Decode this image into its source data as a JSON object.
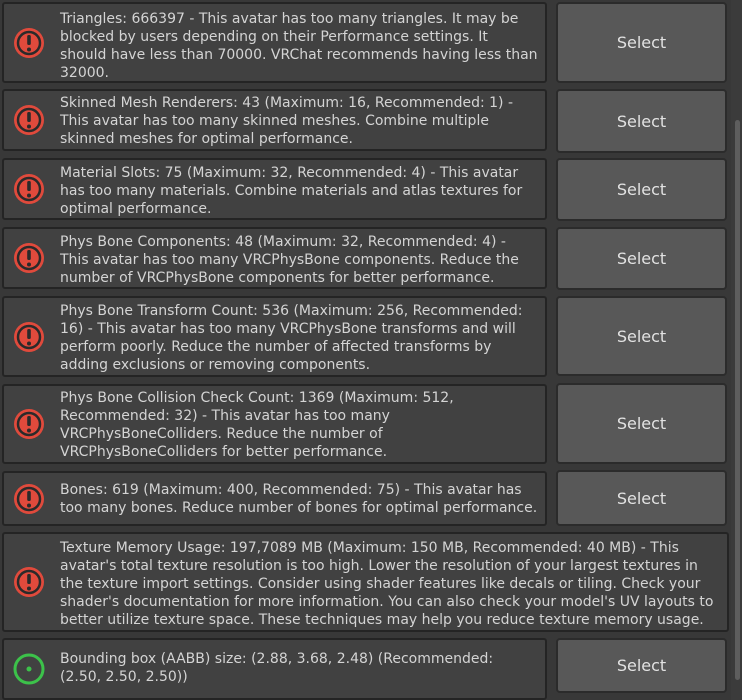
{
  "select_label": "Select",
  "colors": {
    "error": "#e04a3c",
    "ok": "#3cc24a"
  },
  "issues": [
    {
      "type": "error",
      "icon": "error-icon",
      "has_select": true,
      "text": "Triangles: 666397 - This avatar has too many triangles. It may be\nblocked by users depending on their Performance settings. It\nshould have less than 70000. VRChat recommends having less than\n32000."
    },
    {
      "type": "error",
      "icon": "error-icon",
      "has_select": true,
      "text": "Skinned Mesh Renderers: 43 (Maximum: 16, Recommended: 1) -\nThis avatar has too many skinned meshes. Combine multiple\nskinned meshes for optimal performance."
    },
    {
      "type": "error",
      "icon": "error-icon",
      "has_select": true,
      "text": "Material Slots: 75 (Maximum: 32, Recommended: 4) - This avatar\nhas too many materials. Combine materials and atlas textures for\noptimal performance."
    },
    {
      "type": "error",
      "icon": "error-icon",
      "has_select": true,
      "text": "Phys Bone Components: 48 (Maximum: 32, Recommended: 4) -\nThis avatar has too many VRCPhysBone components. Reduce the\nnumber of VRCPhysBone components for better performance."
    },
    {
      "type": "error",
      "icon": "error-icon",
      "has_select": true,
      "text": "Phys Bone Transform Count: 536 (Maximum: 256, Recommended:\n16) - This avatar has too many VRCPhysBone transforms and will\nperform poorly. Reduce the number of affected transforms by\nadding exclusions or removing components."
    },
    {
      "type": "error",
      "icon": "error-icon",
      "has_select": true,
      "text": "Phys Bone Collision Check Count: 1369 (Maximum: 512,\nRecommended: 32) - This avatar has too many\nVRCPhysBoneColliders. Reduce the number of\nVRCPhysBoneColliders for better performance."
    },
    {
      "type": "error",
      "icon": "error-icon",
      "has_select": true,
      "text": "Bones: 619 (Maximum: 400, Recommended: 75) - This avatar has\ntoo many bones. Reduce number of bones for optimal performance."
    },
    {
      "type": "error",
      "icon": "error-icon",
      "has_select": false,
      "text": "Texture Memory Usage: 197,7089 MB (Maximum: 150 MB, Recommended: 40 MB) - This\navatar's total texture resolution is too high. Lower the resolution of your largest textures in\nthe texture import settings. Consider using shader features like decals or tiling. Check your\nshader's documentation for more information. You can also check your model's UV layouts to\nbetter utilize texture space. These techniques may help you reduce texture memory usage."
    },
    {
      "type": "ok",
      "icon": "ok-icon",
      "has_select": true,
      "text": "Bounding box (AABB) size: (2.88, 3.68, 2.48) (Recommended:\n(2.50, 2.50, 2.50))"
    }
  ]
}
